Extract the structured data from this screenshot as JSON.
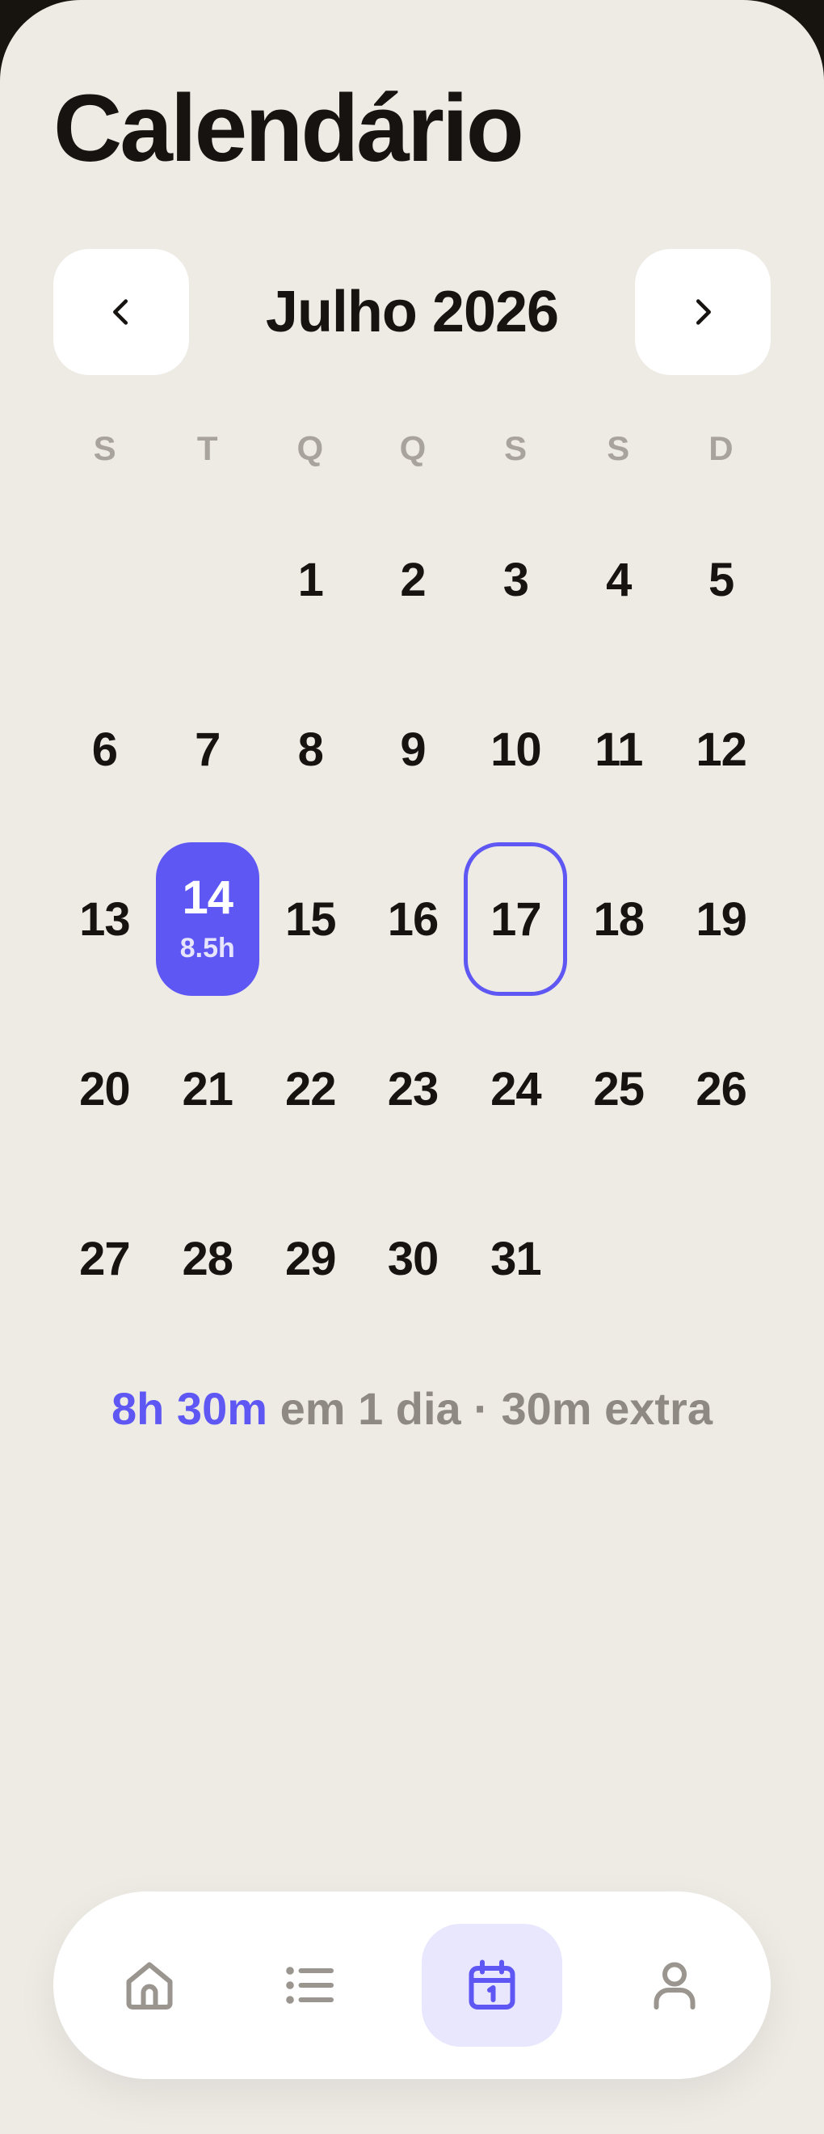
{
  "header": {
    "title": "Calendário"
  },
  "month_nav": {
    "label": "Julho 2026",
    "prev_icon": "chevron-left-icon",
    "next_icon": "chevron-right-icon"
  },
  "weekdays": [
    "S",
    "T",
    "Q",
    "Q",
    "S",
    "S",
    "D"
  ],
  "calendar": {
    "leading_blank_days": 2,
    "selected_day": {
      "number": "14",
      "hours": "8.5h"
    },
    "today_day": "17",
    "weeks": [
      [
        "",
        "",
        "1",
        "2",
        "3",
        "4",
        "5"
      ],
      [
        "6",
        "7",
        "8",
        "9",
        "10",
        "11",
        "12"
      ],
      [
        "13",
        "14",
        "15",
        "16",
        "17",
        "18",
        "19"
      ],
      [
        "20",
        "21",
        "22",
        "23",
        "24",
        "25",
        "26"
      ],
      [
        "27",
        "28",
        "29",
        "30",
        "31",
        "",
        ""
      ]
    ]
  },
  "summary": {
    "total": "8h 30m",
    "detail": " em 1 dia · 30m extra"
  },
  "tabbar": {
    "items": [
      {
        "name": "home",
        "icon": "home-icon",
        "active": false
      },
      {
        "name": "list",
        "icon": "list-icon",
        "active": false
      },
      {
        "name": "calendar",
        "icon": "calendar-icon",
        "active": true
      },
      {
        "name": "profile",
        "icon": "user-icon",
        "active": false
      }
    ]
  },
  "colors": {
    "background": "#eeebe5",
    "accent": "#5e57f4",
    "accent_soft": "#e9e7fe",
    "text": "#161310",
    "muted": "#8e8a83",
    "weekday": "#a8a49d",
    "icon_inactive": "#9a958e"
  }
}
